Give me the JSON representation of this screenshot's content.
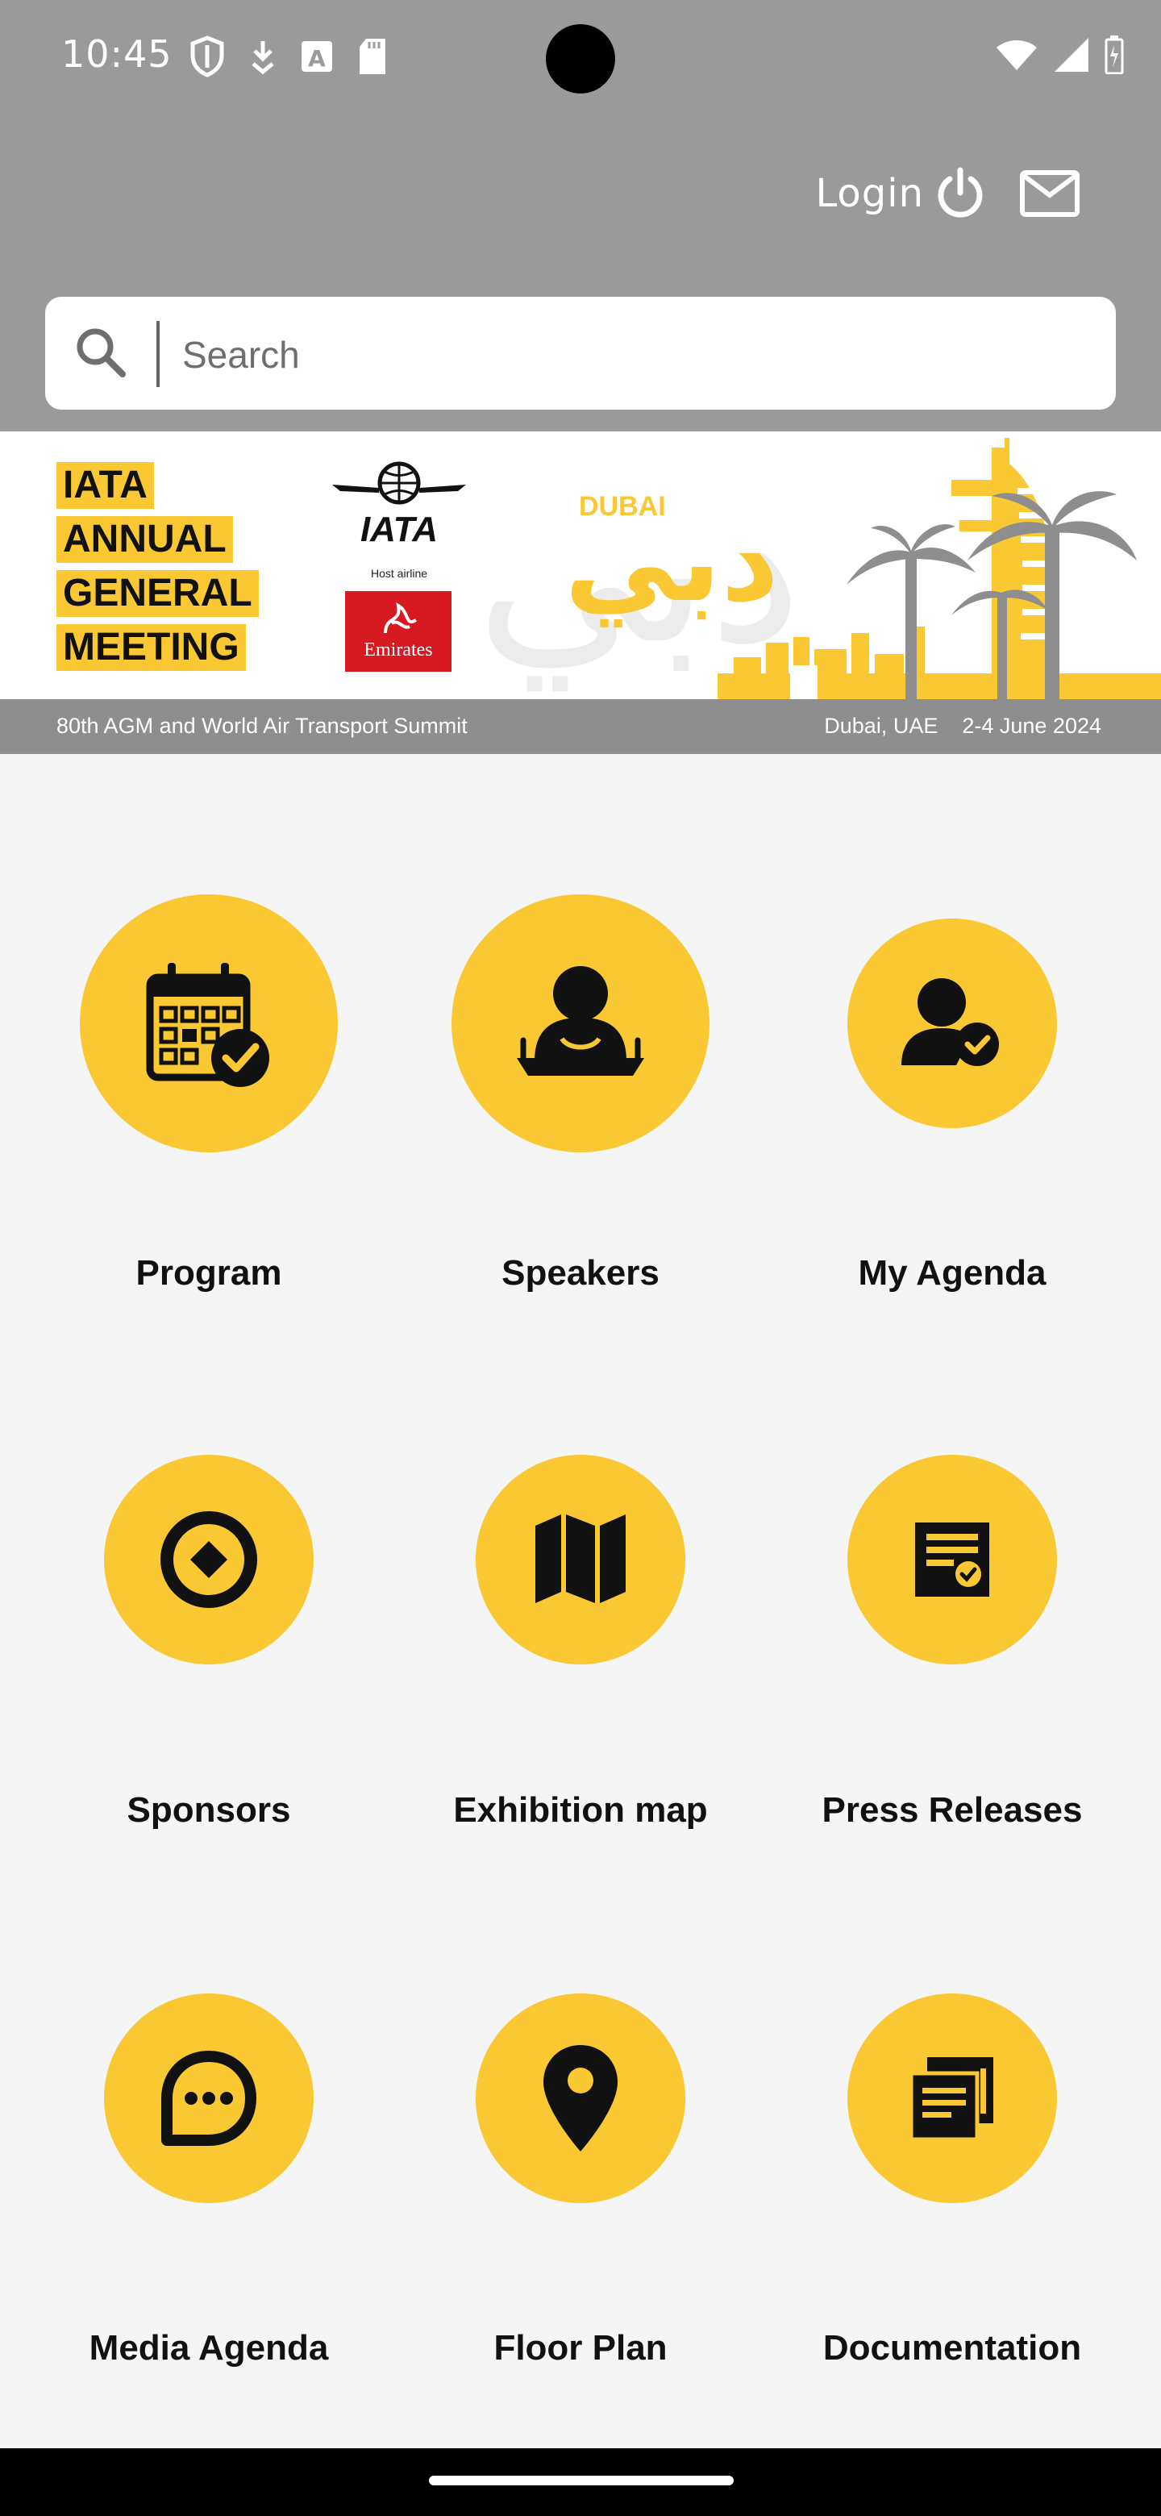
{
  "status_bar": {
    "time": "10:45"
  },
  "topbar": {
    "login_label": "Login"
  },
  "search": {
    "placeholder": "Search"
  },
  "banner": {
    "agm_lines": [
      "IATA",
      "ANNUAL",
      "GENERAL",
      "MEETING"
    ],
    "iata_logo_text": "IATA",
    "host_airline_label": "Host airline",
    "emirates_text": "Emirates",
    "dubai_text": "DUBAI",
    "dubai_arabic": "دبي",
    "strip_left": "80th AGM and World Air Transport Summit",
    "strip_location": "Dubai, UAE",
    "strip_dates": "2-4 June 2024"
  },
  "menu": {
    "items": [
      {
        "label": "Program",
        "icon": "calendar-check-icon"
      },
      {
        "label": "Speakers",
        "icon": "speaker-podium-icon"
      },
      {
        "label": "My Agenda",
        "icon": "person-check-icon"
      },
      {
        "label": "Sponsors",
        "icon": "target-diamond-icon"
      },
      {
        "label": "Exhibition map",
        "icon": "map-icon"
      },
      {
        "label": "Press Releases",
        "icon": "document-check-icon"
      },
      {
        "label": "Media Agenda",
        "icon": "chat-bubble-icon"
      },
      {
        "label": "Floor Plan",
        "icon": "location-pin-icon"
      },
      {
        "label": "Documentation",
        "icon": "documents-icon"
      }
    ]
  },
  "colors": {
    "accent": "#f9c833",
    "header_bg": "#9a9a9a",
    "page_bg": "#f5f5f5"
  }
}
